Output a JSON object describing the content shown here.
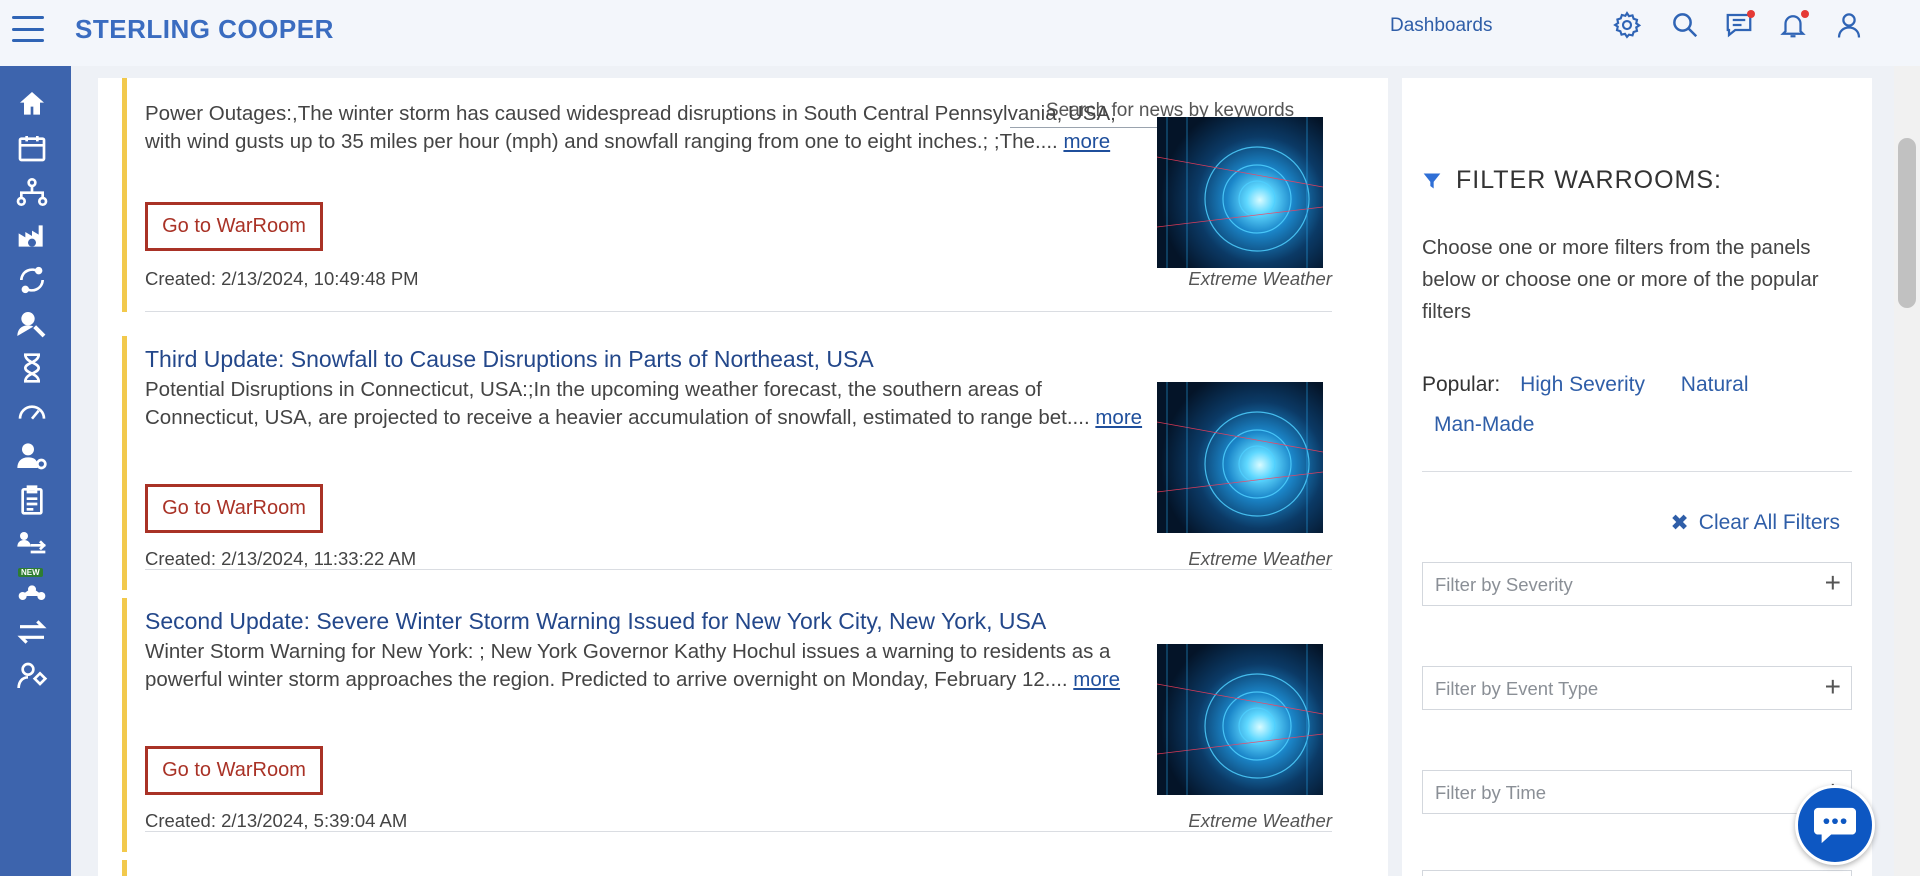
{
  "header": {
    "brand": "STERLING COOPER",
    "dashboards_link": "Dashboards"
  },
  "search": {
    "placeholder": "Search for news by keywords"
  },
  "news": [
    {
      "title": "",
      "body": "Power Outages:,The winter storm has caused widespread disruptions in South Central Pennsylvania, USA, with wind gusts up to 35 miles per hour (mph) and snowfall ranging from one to eight inches.; ;The....",
      "more": "more",
      "button": "Go to WarRoom",
      "created": "Created: 2/13/2024, 10:49:48 PM",
      "category": "Extreme Weather"
    },
    {
      "title": "Third Update: Snowfall to Cause Disruptions in Parts of Northeast, USA",
      "body": "Potential Disruptions in Connecticut, USA:;In the upcoming weather forecast, the southern areas of Connecticut, USA, are projected to receive a heavier accumulation of snowfall, estimated to range bet....",
      "more": "more",
      "button": "Go to WarRoom",
      "created": "Created: 2/13/2024, 11:33:22 AM",
      "category": "Extreme Weather"
    },
    {
      "title": "Second Update: Severe Winter Storm Warning Issued for New York City, New York, USA",
      "body": "Winter Storm Warning for New York: ; New York Governor Kathy Hochul issues a warning to residents as a powerful winter storm approaches the region. Predicted to arrive overnight on Monday, February 12....",
      "more": "more",
      "button": "Go to WarRoom",
      "created": "Created: 2/13/2024, 5:39:04 AM",
      "category": "Extreme Weather"
    }
  ],
  "filters": {
    "title": "FILTER  WARROOMS:",
    "description": "Choose one or more filters from the panels below or choose one or more of the popular filters",
    "popular_label": "Popular:",
    "popular": [
      "High Severity",
      "Natural",
      "Man-Made"
    ],
    "clear_all": "Clear All Filters",
    "boxes": [
      "Filter by Severity",
      "Filter by Event Type",
      "Filter by Time"
    ]
  },
  "rail": {
    "new_badge": "NEW"
  },
  "colors": {
    "rail": "#3d64ad",
    "accent": "#2f5ea8",
    "warroom": "#a93226",
    "news_bar": "#f2c94c",
    "chat": "#0d57c2"
  }
}
